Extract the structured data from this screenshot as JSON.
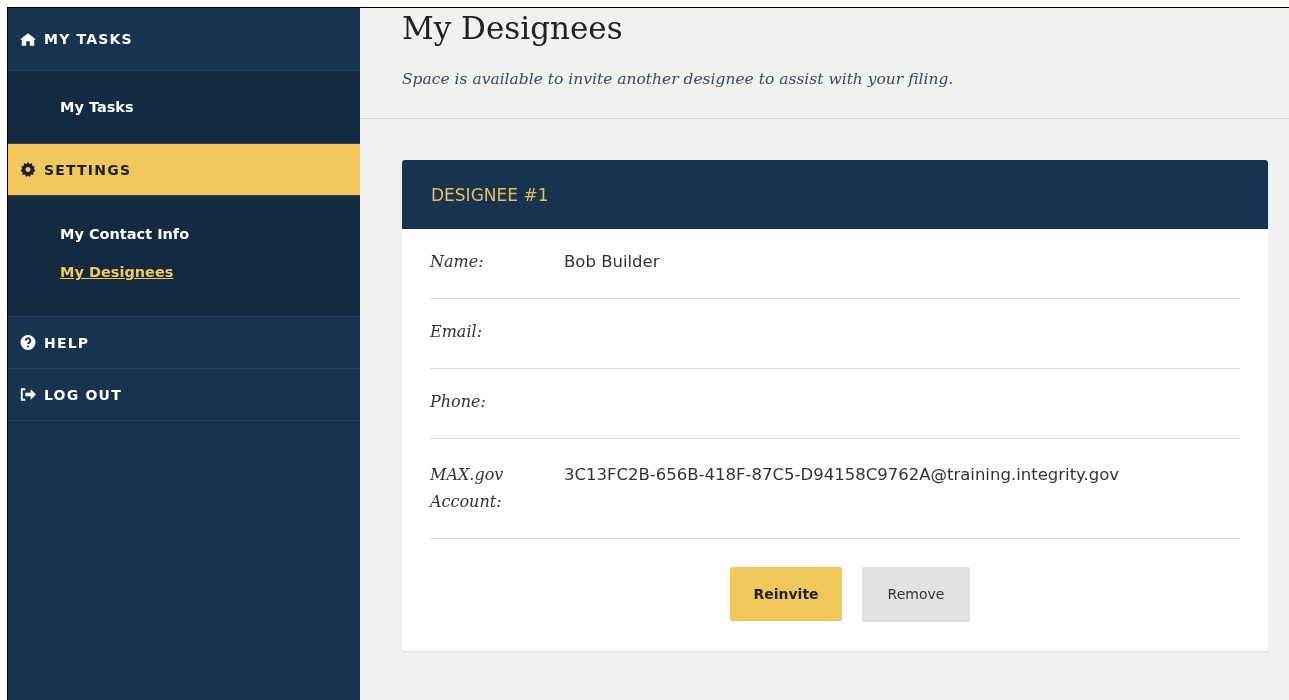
{
  "sidebar": {
    "sections": [
      {
        "label": "MY TASKS",
        "selected": false,
        "items": [
          {
            "label": "My Tasks",
            "selected": false
          }
        ]
      },
      {
        "label": "SETTINGS",
        "selected": true,
        "items": [
          {
            "label": "My Contact Info",
            "selected": false
          },
          {
            "label": "My Designees",
            "selected": true
          }
        ]
      },
      {
        "label": "HELP",
        "selected": false
      },
      {
        "label": "LOG OUT",
        "selected": false
      }
    ]
  },
  "page": {
    "title": "My Designees",
    "subtitle": "Space is available to invite another designee to assist with your filing."
  },
  "card": {
    "title": "DESIGNEE #1",
    "fields": [
      {
        "label": "Name:",
        "value": "Bob Builder"
      },
      {
        "label": "Email:"
      },
      {
        "label": "Phone:"
      },
      {
        "label": "MAX.gov Account:",
        "value": "3C13FC2B-656B-418F-87C5-D94158C9762A@training.integrity.gov"
      }
    ],
    "buttons": [
      {
        "label": "Reinvite",
        "kind": "primary"
      },
      {
        "label": "Remove",
        "kind": "secondary"
      }
    ]
  }
}
